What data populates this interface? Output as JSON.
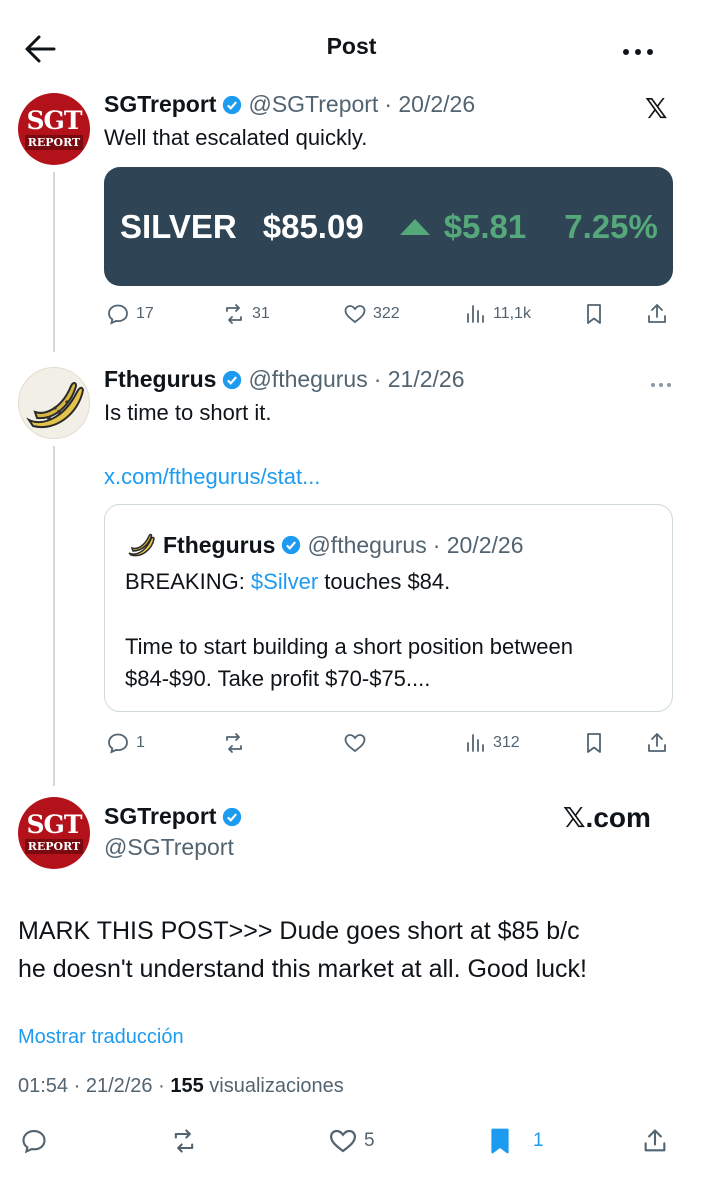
{
  "header": {
    "title": "Post"
  },
  "post1": {
    "name": "SGTreport",
    "handle": "@SGTreport",
    "date": "· 20/2/26",
    "text": "Well that escalated quickly.",
    "avatar_text1": "SGT",
    "avatar_text2": "REPORT",
    "card": {
      "label": "SILVER",
      "price": "$85.09",
      "change": "$5.81",
      "percent": "7.25%"
    },
    "stats": {
      "replies": "17",
      "reposts": "31",
      "likes": "322",
      "views": "11,1k"
    }
  },
  "post2": {
    "name": "Fthegurus",
    "handle": "@fthegurus",
    "date": "· 21/2/26",
    "text": "Is time to short it.",
    "link": "x.com/fthegurus/stat...",
    "quote": {
      "name": "Fthegurus",
      "handle": "@fthegurus",
      "date": "· 20/2/26",
      "line1_prefix": "BREAKING: ",
      "cashtag": "$Silver",
      "line1_suffix": " touches $84.",
      "line2": "Time to start building a short position between",
      "line3": "$84-$90. Take profit $70-$75...."
    },
    "stats": {
      "replies": "1",
      "views": "312"
    }
  },
  "post3": {
    "name": "SGTreport",
    "handle": "@SGTreport",
    "avatar_text1": "SGT",
    "avatar_text2": "REPORT",
    "brand": "𝕏.com",
    "text_line1": "MARK THIS POST>>> Dude goes short at $85 b/c",
    "text_line2": "he doesn't understand this market at all. Good luck!",
    "translate": "Mostrar traducción",
    "meta_time": "01:54 · 21/2/26 · ",
    "meta_views_count": "155",
    "meta_views_label": " visualizaciones",
    "stats": {
      "likes": "5",
      "bookmarks": "1"
    }
  },
  "colors": {
    "accent": "#1d9bf0",
    "silver_bg": "#2f4454",
    "up_green": "#55a87a",
    "sgt_red": "#b3121b"
  }
}
